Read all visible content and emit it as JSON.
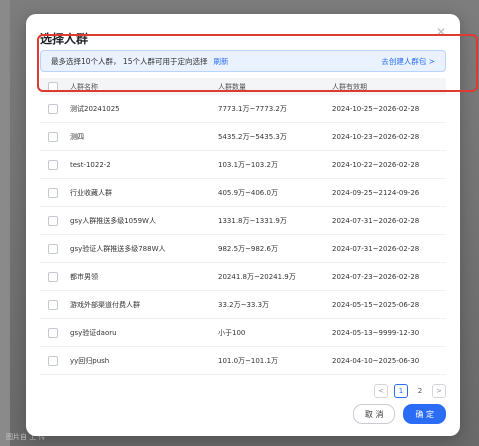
{
  "background": {
    "footer_text": "图片自 上 传"
  },
  "modal": {
    "title": "选择人群",
    "close_icon": "close-icon",
    "info": {
      "message": "最多选择10个人群， 15个人群可用于定向选择",
      "refresh": "刷新",
      "create": "去创建人群包 >"
    },
    "table": {
      "headers": [
        "人群名称",
        "人群数量",
        "人群有效期"
      ],
      "rows": [
        {
          "name": "测试20241025",
          "count": "7773.1万~7773.2万",
          "valid": "2024-10-25~2026-02-28"
        },
        {
          "name": "测四",
          "count": "5435.2万~5435.3万",
          "valid": "2024-10-23~2026-02-28"
        },
        {
          "name": "test-1022-2",
          "count": "103.1万~103.2万",
          "valid": "2024-10-22~2026-02-28"
        },
        {
          "name": "行业收藏人群",
          "count": "405.9万~406.0万",
          "valid": "2024-09-25~2124-09-26"
        },
        {
          "name": "gsy人群推送多级1059W人",
          "count": "1331.8万~1331.9万",
          "valid": "2024-07-31~2026-02-28"
        },
        {
          "name": "gsy验证人群推送多级788W人",
          "count": "982.5万~982.6万",
          "valid": "2024-07-31~2026-02-28"
        },
        {
          "name": "都市男领",
          "count": "20241.8万~20241.9万",
          "valid": "2024-07-23~2026-02-28"
        },
        {
          "name": "游戏外部渠道付费人群",
          "count": "33.2万~33.3万",
          "valid": "2024-05-15~2025-06-28"
        },
        {
          "name": "gsy验证daoru",
          "count": "小于100",
          "valid": "2024-05-13~9999-12-30"
        },
        {
          "name": "yy回归push",
          "count": "101.0万~101.1万",
          "valid": "2024-04-10~2025-06-30"
        }
      ]
    },
    "pagination": {
      "prev": "<",
      "pages": [
        "1",
        "2"
      ],
      "current": "1",
      "next": ">"
    },
    "buttons": {
      "cancel": "取 消",
      "ok": "确 定"
    }
  },
  "colors": {
    "primary": "#2a6cf6",
    "highlight": "#e0392f",
    "info_bg": "#eaf2ff"
  }
}
